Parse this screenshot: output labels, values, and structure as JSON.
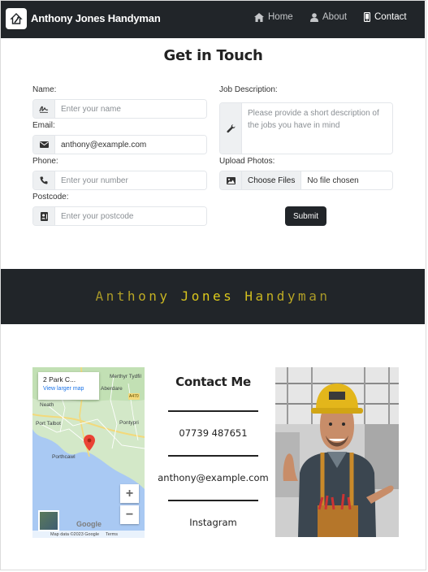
{
  "navbar": {
    "brand": "Anthony Jones Handyman",
    "logo_icon": "house-hammer-icon",
    "links": [
      {
        "label": "Home",
        "icon": "home-icon"
      },
      {
        "label": "About",
        "icon": "user-icon"
      },
      {
        "label": "Contact",
        "icon": "phone-icon",
        "active": true
      }
    ]
  },
  "form": {
    "title": "Get in Touch",
    "name": {
      "label": "Name:",
      "placeholder": "Enter your name",
      "icon": "signature-icon"
    },
    "email": {
      "label": "Email:",
      "value": "anthony@example.com",
      "icon": "envelope-icon"
    },
    "phone": {
      "label": "Phone:",
      "placeholder": "Enter your number",
      "icon": "phone-icon"
    },
    "postcode": {
      "label": "Postcode:",
      "placeholder": "Enter your postcode",
      "icon": "address-card-icon"
    },
    "job": {
      "label": "Job Description:",
      "placeholder": "Please provide a short description of the jobs you have in mind",
      "icon": "wrench-icon"
    },
    "photos": {
      "label": "Upload Photos:",
      "button": "Choose Files",
      "status": "No file chosen",
      "icon": "image-icon"
    },
    "submit": "Submit"
  },
  "banner": {
    "text": "Anthony Jones Handyman"
  },
  "map": {
    "card_title": "2 Park C...",
    "card_link": "View larger map",
    "zoom_in": "+",
    "zoom_out": "−",
    "google": "Google",
    "attribution": "Map data ©2023 Google",
    "terms": "Terms",
    "towns": [
      "Merthyr Tydfil",
      "Aberdare",
      "Neath",
      "Port Talbot",
      "Pontypri",
      "Porthcawl"
    ],
    "road_badge": "A470"
  },
  "contact": {
    "title": "Contact Me",
    "phone": "07739 487651",
    "email": "anthony@example.com",
    "social": "Instagram"
  },
  "colors": {
    "dark": "#212529",
    "banner_gold": "#e6d219",
    "map_water": "#a9c9f3",
    "map_land": "#cfe6c4",
    "pin": "#ea4335"
  }
}
